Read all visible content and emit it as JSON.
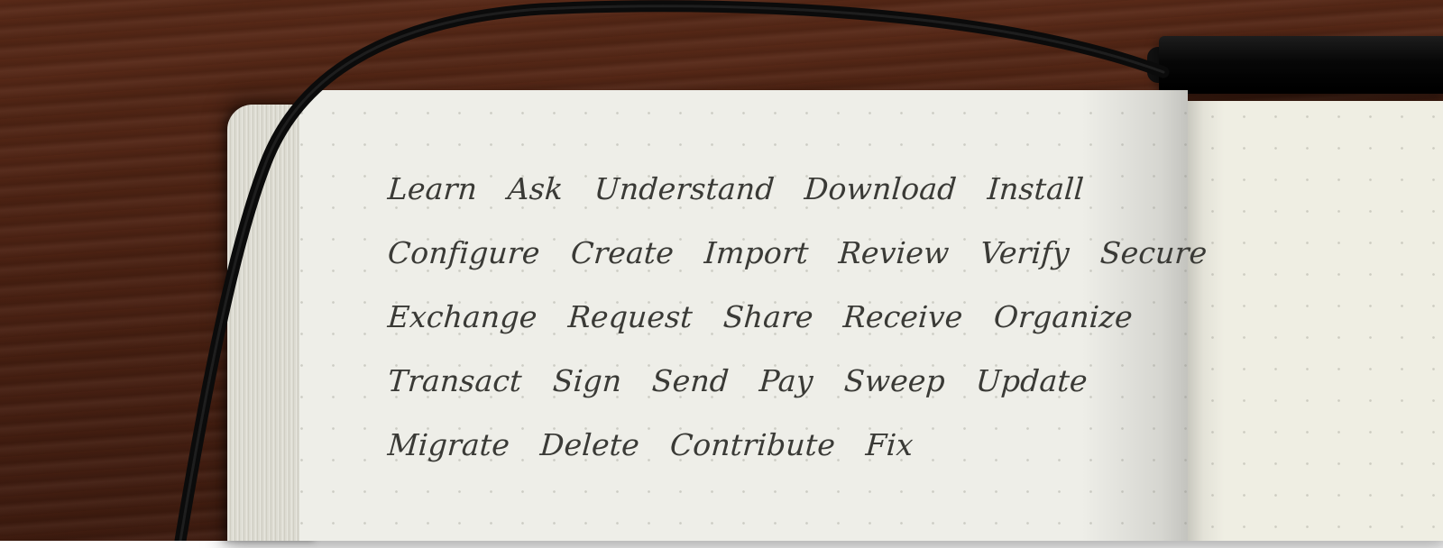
{
  "notebook": {
    "lines": [
      [
        "Learn",
        "Ask",
        "Understand",
        "Download",
        "Install"
      ],
      [
        "Configure",
        "Create",
        "Import",
        "Review",
        "Verify",
        "Secure"
      ],
      [
        "Exchange",
        "Request",
        "Share",
        "Receive",
        "Organize"
      ],
      [
        "Transact",
        "Sign",
        "Send",
        "Pay",
        "Sweep",
        "Update"
      ],
      [
        "Migrate",
        "Delete",
        "Contribute",
        "Fix"
      ]
    ]
  },
  "colors": {
    "desk": "#4c2213",
    "paper": "#eeeee8",
    "ink": "#3a3a36",
    "ribbon": "#0b0b0b"
  }
}
